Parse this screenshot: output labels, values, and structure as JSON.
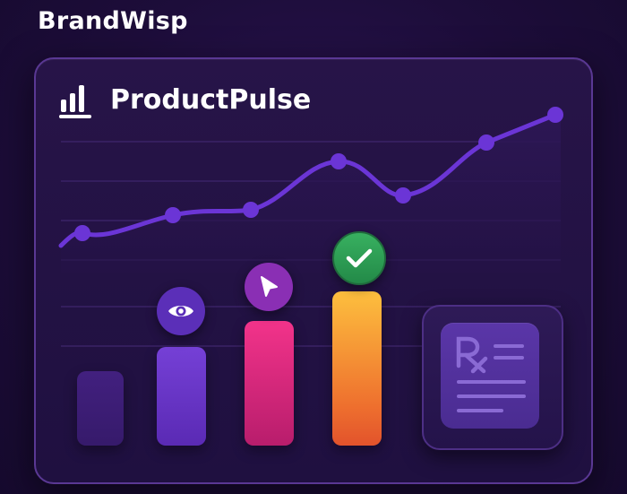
{
  "brand": {
    "name": "BrandWisp"
  },
  "card": {
    "title": "ProductPulse"
  },
  "icons": {
    "logo": "bar-chart-icon",
    "eye": "eye-icon",
    "cursor": "cursor-arrow-icon",
    "check": "checkmark-icon",
    "prescription": "prescription-document-icon"
  },
  "colors": {
    "background": "#1d0d3a",
    "card": "#241246",
    "line": "#6b35d6",
    "bar1": "#3d1f78",
    "bar2": "#6a35c9",
    "bar3": "#e8307f",
    "bar4": "#f6a23c",
    "check_badge": "#2e9a56"
  }
}
